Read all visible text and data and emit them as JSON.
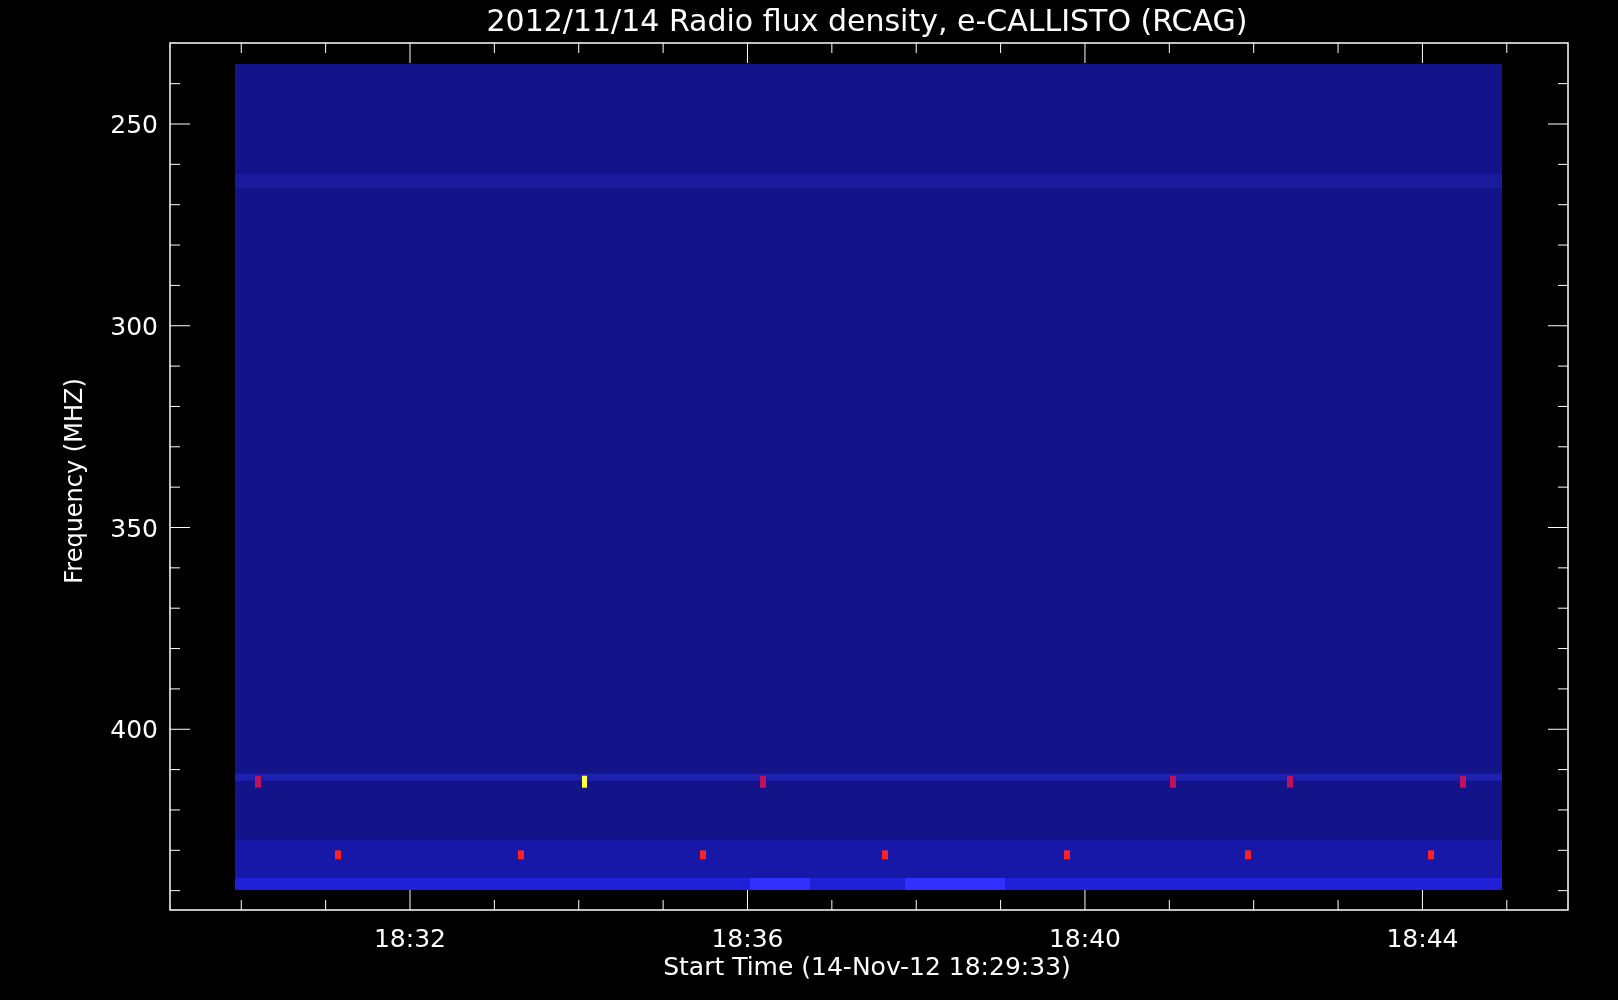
{
  "title": "2012/11/14  Radio flux density, e-CALLISTO (RCAG)",
  "y_axis": {
    "label": "Frequency (MHZ)",
    "ticks": [
      "250",
      "300",
      "350",
      "400"
    ]
  },
  "x_axis": {
    "label": "Start Time (14-Nov-12 18:29:33)",
    "ticks": [
      "18:32",
      "18:36",
      "18:40",
      "18:44"
    ]
  }
}
